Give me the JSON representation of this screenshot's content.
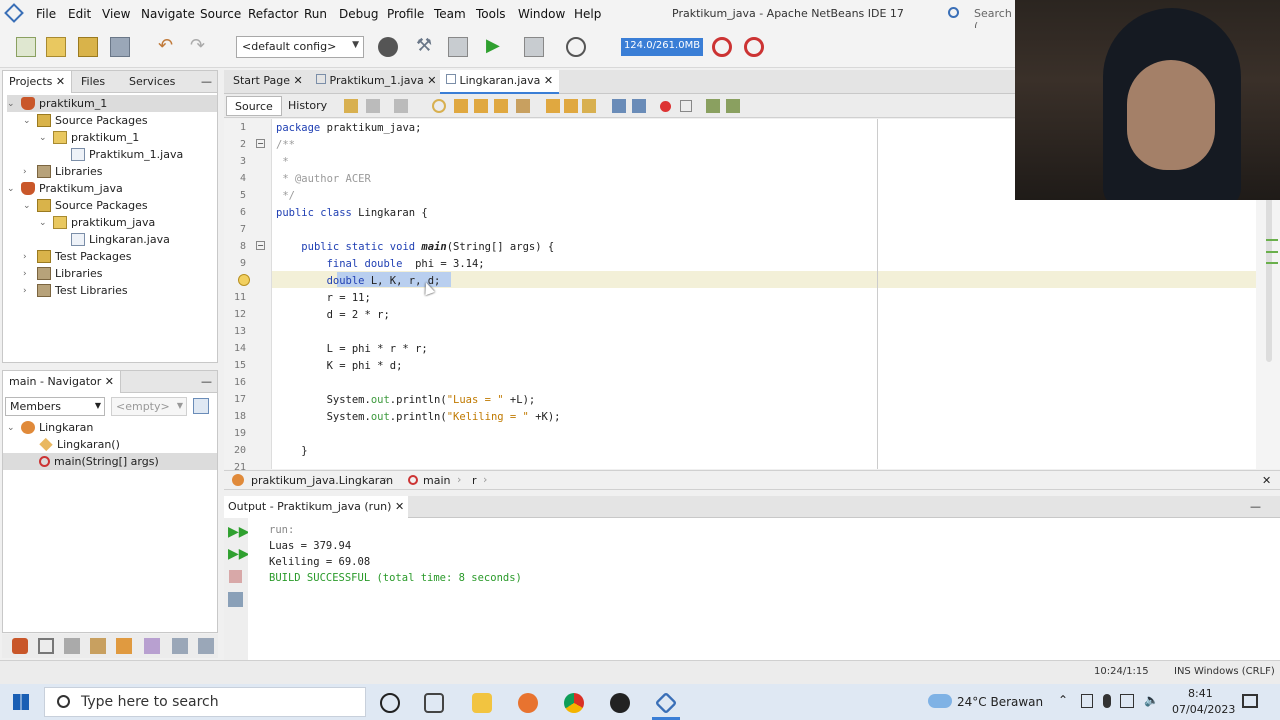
{
  "window": {
    "title": "Praktikum_java - Apache NetBeans IDE 17",
    "search_placeholder": "Search ("
  },
  "menu": [
    "File",
    "Edit",
    "View",
    "Navigate",
    "Source",
    "Refactor",
    "Run",
    "Debug",
    "Profile",
    "Team",
    "Tools",
    "Window",
    "Help"
  ],
  "toolbar": {
    "config": "<default config>",
    "memory": "124.0/261.0MB"
  },
  "projects_panel": {
    "tabs": [
      "Projects",
      "Files",
      "Services"
    ],
    "tree": [
      {
        "label": "praktikum_1",
        "icon": "project-icon",
        "level": 0
      },
      {
        "label": "Source Packages",
        "icon": "source-packages-icon",
        "level": 1
      },
      {
        "label": "praktikum_1",
        "icon": "package-icon",
        "level": 2
      },
      {
        "label": "Praktikum_1.java",
        "icon": "java-file-icon",
        "level": 3
      },
      {
        "label": "Libraries",
        "icon": "libraries-icon",
        "level": 1
      },
      {
        "label": "Praktikum_java",
        "icon": "project-icon",
        "level": 0
      },
      {
        "label": "Source Packages",
        "icon": "source-packages-icon",
        "level": 1
      },
      {
        "label": "praktikum_java",
        "icon": "package-icon",
        "level": 2
      },
      {
        "label": "Lingkaran.java",
        "icon": "java-file-icon",
        "level": 3
      },
      {
        "label": "Test Packages",
        "icon": "test-packages-icon",
        "level": 1
      },
      {
        "label": "Libraries",
        "icon": "libraries-icon",
        "level": 1
      },
      {
        "label": "Test Libraries",
        "icon": "test-libraries-icon",
        "level": 1
      }
    ]
  },
  "navigator": {
    "title": "main - Navigator",
    "members_label": "Members",
    "filter": "<empty>",
    "tree": [
      {
        "label": "Lingkaran",
        "level": 0
      },
      {
        "label": "Lingkaran()",
        "level": 1
      },
      {
        "label": "main(String[] args)",
        "level": 1
      }
    ]
  },
  "editor": {
    "tabs": [
      "Start Page",
      "Praktikum_1.java",
      "Lingkaran.java"
    ],
    "source_label": "Source",
    "history_label": "History",
    "line_numbers": [
      "1",
      "2",
      "3",
      "4",
      "5",
      "6",
      "7",
      "8",
      "9",
      "10",
      "11",
      "12",
      "13",
      "14",
      "15",
      "16",
      "17",
      "18",
      "19",
      "20",
      "21"
    ],
    "breadcrumb": [
      "praktikum_java.Lingkaran",
      "main",
      "r"
    ]
  },
  "output": {
    "tab": "Output - Praktikum_java (run)",
    "lines": [
      "run:",
      "Luas = 379.94",
      "Keliling = 69.08",
      "BUILD SUCCESSFUL (total time: 8 seconds)"
    ]
  },
  "status": {
    "position": "10:24/1:15",
    "mode": "INS Windows (CRLF)"
  },
  "taskbar": {
    "search_placeholder": "Type here to search",
    "weather": "24°C Berawan",
    "time": "8:41",
    "date": "07/04/2023"
  }
}
